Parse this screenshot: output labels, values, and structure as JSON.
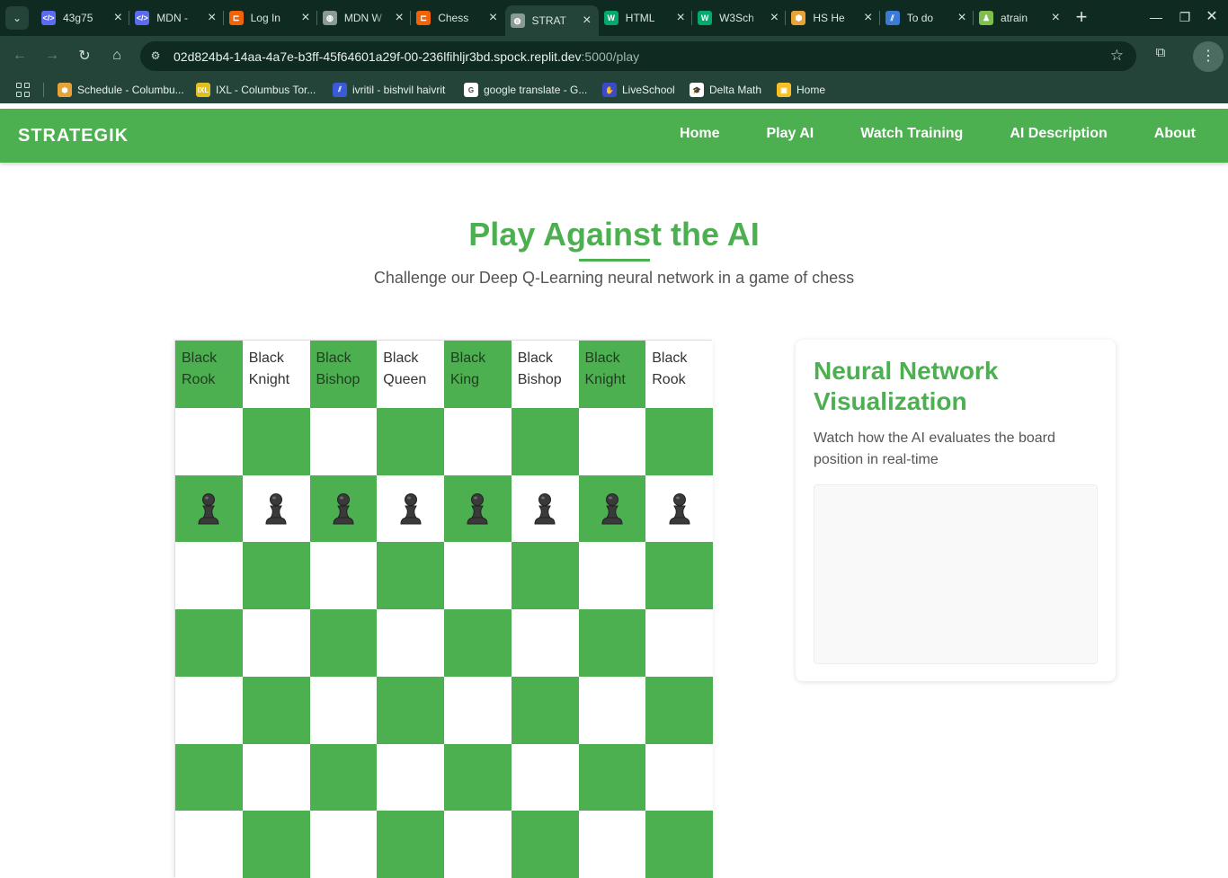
{
  "browser": {
    "tabs": [
      {
        "title": "43g75",
        "icon": "code-icon",
        "color": "#5b6cf0",
        "active": false
      },
      {
        "title": "MDN -",
        "icon": "code-icon",
        "color": "#5b6cf0",
        "active": false
      },
      {
        "title": "Log In",
        "icon": "replit-icon",
        "color": "#f26207",
        "active": false
      },
      {
        "title": "MDN W",
        "icon": "globe-icon",
        "color": "#8a9a94",
        "active": false
      },
      {
        "title": "Chess",
        "icon": "replit-icon",
        "color": "#f26207",
        "active": false
      },
      {
        "title": "STRAT",
        "icon": "globe-icon",
        "color": "#8a9a94",
        "active": true
      },
      {
        "title": "HTML",
        "icon": "w3schools-icon",
        "color": "#04aa6d",
        "active": false
      },
      {
        "title": "W3Sch",
        "icon": "w3schools-icon",
        "color": "#04aa6d",
        "active": false
      },
      {
        "title": "HS He",
        "icon": "cube-icon",
        "color": "#e8a23a",
        "active": false
      },
      {
        "title": "To do",
        "icon": "stripes-icon",
        "color": "#3a7bd5",
        "active": false
      },
      {
        "title": "atrain",
        "icon": "chess-icon",
        "color": "#7fbf4d",
        "active": false
      }
    ],
    "url_host": "02d824b4-14aa-4a7e-b3ff-45f64601a29f-00-236lfihljr3bd.spock.replit.dev",
    "url_path": ":5000/play",
    "bookmarks": [
      {
        "label": "Schedule - Columbu...",
        "icon": "cube-icon",
        "color": "#e8a23a"
      },
      {
        "label": "IXL - Columbus Tor...",
        "icon": "ixl-icon",
        "color": "#e0c020"
      },
      {
        "label": "ivritil - bishvil haivrit",
        "icon": "stripes-icon",
        "color": "#3a5bd5"
      },
      {
        "label": "google translate - G...",
        "icon": "google-icon",
        "color": "#ffffff"
      },
      {
        "label": "LiveSchool",
        "icon": "hand-icon",
        "color": "#3b4bc8"
      },
      {
        "label": "Delta Math",
        "icon": "graduation-icon",
        "color": "#ffffff"
      },
      {
        "label": "Home",
        "icon": "classroom-icon",
        "color": "#f6c026"
      }
    ]
  },
  "site": {
    "brand": "STRATEGIK",
    "nav": [
      "Home",
      "Play AI",
      "Watch Training",
      "AI Description",
      "About"
    ],
    "hero": {
      "title": "Play Against the AI",
      "subtitle": "Challenge our Deep Q-Learning neural network in a game of chess"
    },
    "board": {
      "back_rank_alts": [
        "Black Rook",
        "Black Knight",
        "Black Bishop",
        "Black Queen",
        "Black King",
        "Black Bishop",
        "Black Knight",
        "Black Rook"
      ],
      "pawn_rank_index": 2,
      "pawn_glyph": "♟"
    },
    "nn": {
      "title": "Neural Network Visualization",
      "description": "Watch how the AI evaluates the board position in real-time"
    }
  }
}
